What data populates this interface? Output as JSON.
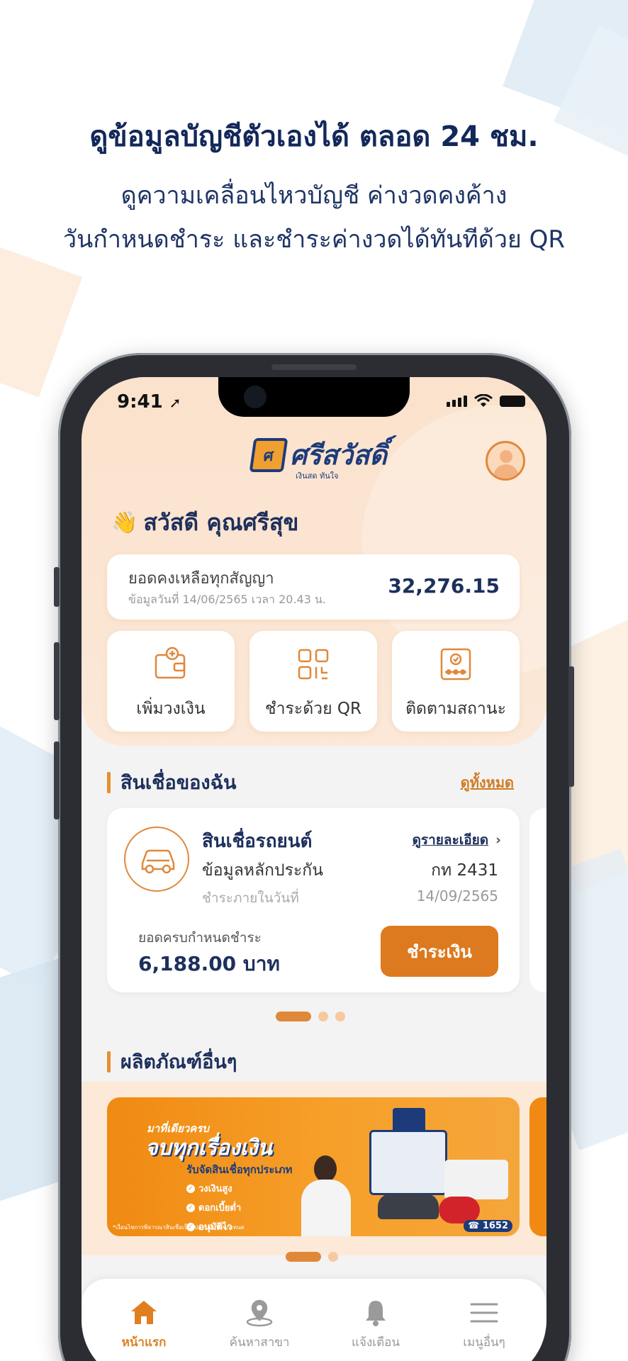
{
  "promo": {
    "headline": "ดูข้อมูลบัญชีตัวเองได้ ตลอด 24 ชม.",
    "subline_1": "ดูความเคลื่อนไหวบัญชี ค่างวดคงค้าง",
    "subline_2": "วันกำหนดชำระ และชำระค่างวดได้ทันทีด้วย QR"
  },
  "status_bar": {
    "time": "9:41"
  },
  "app": {
    "logo_text": "ศรีสวัสดิ์",
    "logo_tagline": "เงินสด ทันใจ",
    "greeting_emoji": "👋",
    "greeting": "สวัสดี คุณศรีสุข"
  },
  "balance": {
    "label": "ยอดคงเหลือทุกสัญญา",
    "as_of": "ข้อมูลวันที่ 14/06/2565 เวลา 20.43 น.",
    "amount": "32,276.15"
  },
  "quick_actions": [
    {
      "label": "เพิ่มวงเงิน",
      "icon": "wallet-plus-icon"
    },
    {
      "label": "ชำระด้วย QR",
      "icon": "qr-code-icon"
    },
    {
      "label": "ติดตามสถานะ",
      "icon": "status-tracking-icon"
    }
  ],
  "my_loans": {
    "title": "สินเชื่อของฉัน",
    "see_all": "ดูทั้งหมด",
    "card": {
      "name": "สินเชื่อรถยนต์",
      "detail_link": "ดูรายละเอียด",
      "collateral_label": "ข้อมูลหลักประกัน",
      "collateral_value": "กท 2431",
      "due_label": "ชำระภายในวันที่",
      "due_date": "14/09/2565",
      "amount_label": "ยอดครบกำหนดชำระ",
      "amount": "6,188.00 บาท",
      "pay_button": "ชำระเงิน"
    }
  },
  "other_products": {
    "title": "ผลิตภัณฑ์อื่นๆ",
    "banner": {
      "lead": "มาที่เดียวครบ",
      "title": "จบทุกเรื่องเงิน",
      "subtitle": "รับจัดสินเชื่อทุกประเภท",
      "bullets": [
        "วงเงินสูง",
        "ดอกเบี้ยต่ำ",
        "อนุมัติไว"
      ],
      "phone": "1652",
      "fine_print": "*เงื่อนไขการพิจารณาสินเชื่อเป็นไปตามที่บริษัทกำหนด"
    }
  },
  "tabbar": [
    {
      "label": "หน้าแรก",
      "icon": "home-icon",
      "active": true
    },
    {
      "label": "ค้นหาสาขา",
      "icon": "map-pin-icon",
      "active": false
    },
    {
      "label": "แจ้งเตือน",
      "icon": "bell-icon",
      "active": false
    },
    {
      "label": "เมนูอื่นๆ",
      "icon": "menu-icon",
      "active": false
    }
  ],
  "colors": {
    "accent": "#dd7a1f",
    "navy": "#1d2f5c",
    "header_bg": "#fbe2cc"
  }
}
